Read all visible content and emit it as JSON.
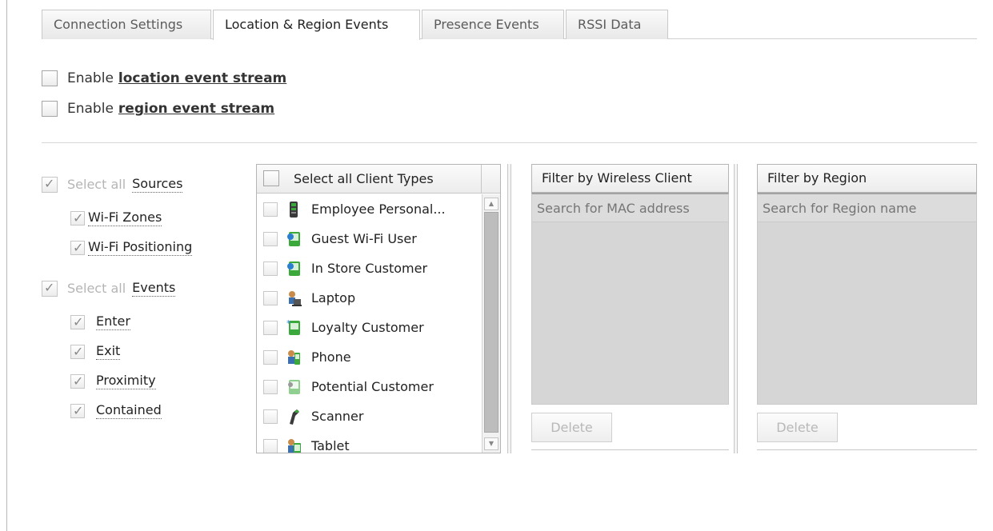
{
  "tabs": [
    {
      "label": "Connection Settings"
    },
    {
      "label": "Location & Region Events"
    },
    {
      "label": "Presence Events"
    },
    {
      "label": "RSSI Data"
    }
  ],
  "stream_toggles": {
    "enable_prefix": "Enable",
    "location_link": "location event stream",
    "region_link": "region event stream"
  },
  "sources": {
    "select_all": "Select all",
    "title": "Sources",
    "items": [
      "Wi-Fi Zones",
      "Wi-Fi Positioning"
    ]
  },
  "events": {
    "select_all": "Select all",
    "title": "Events",
    "items": [
      "Enter",
      "Exit",
      "Proximity",
      "Contained"
    ]
  },
  "client_types": {
    "header": "Select all Client Types",
    "items": [
      {
        "label": "Employee Personal...",
        "icon": "employee-device-icon"
      },
      {
        "label": "Guest Wi-Fi User",
        "icon": "guest-user-icon"
      },
      {
        "label": "In Store Customer",
        "icon": "store-customer-icon"
      },
      {
        "label": "Laptop",
        "icon": "laptop-icon"
      },
      {
        "label": "Loyalty Customer",
        "icon": "loyalty-customer-icon"
      },
      {
        "label": "Phone",
        "icon": "phone-icon"
      },
      {
        "label": "Potential Customer",
        "icon": "potential-customer-icon"
      },
      {
        "label": "Scanner",
        "icon": "scanner-icon"
      },
      {
        "label": "Tablet",
        "icon": "tablet-icon"
      }
    ]
  },
  "wireless_filter": {
    "header": "Filter by Wireless Client",
    "placeholder": "Search for MAC address",
    "delete": "Delete"
  },
  "region_filter": {
    "header": "Filter by Region",
    "placeholder": "Search for Region name",
    "delete": "Delete"
  },
  "colors": {
    "icon_green": "#3aa83a",
    "icon_dark": "#4a4a4a",
    "disabled_panel": "#d6d6d6"
  }
}
